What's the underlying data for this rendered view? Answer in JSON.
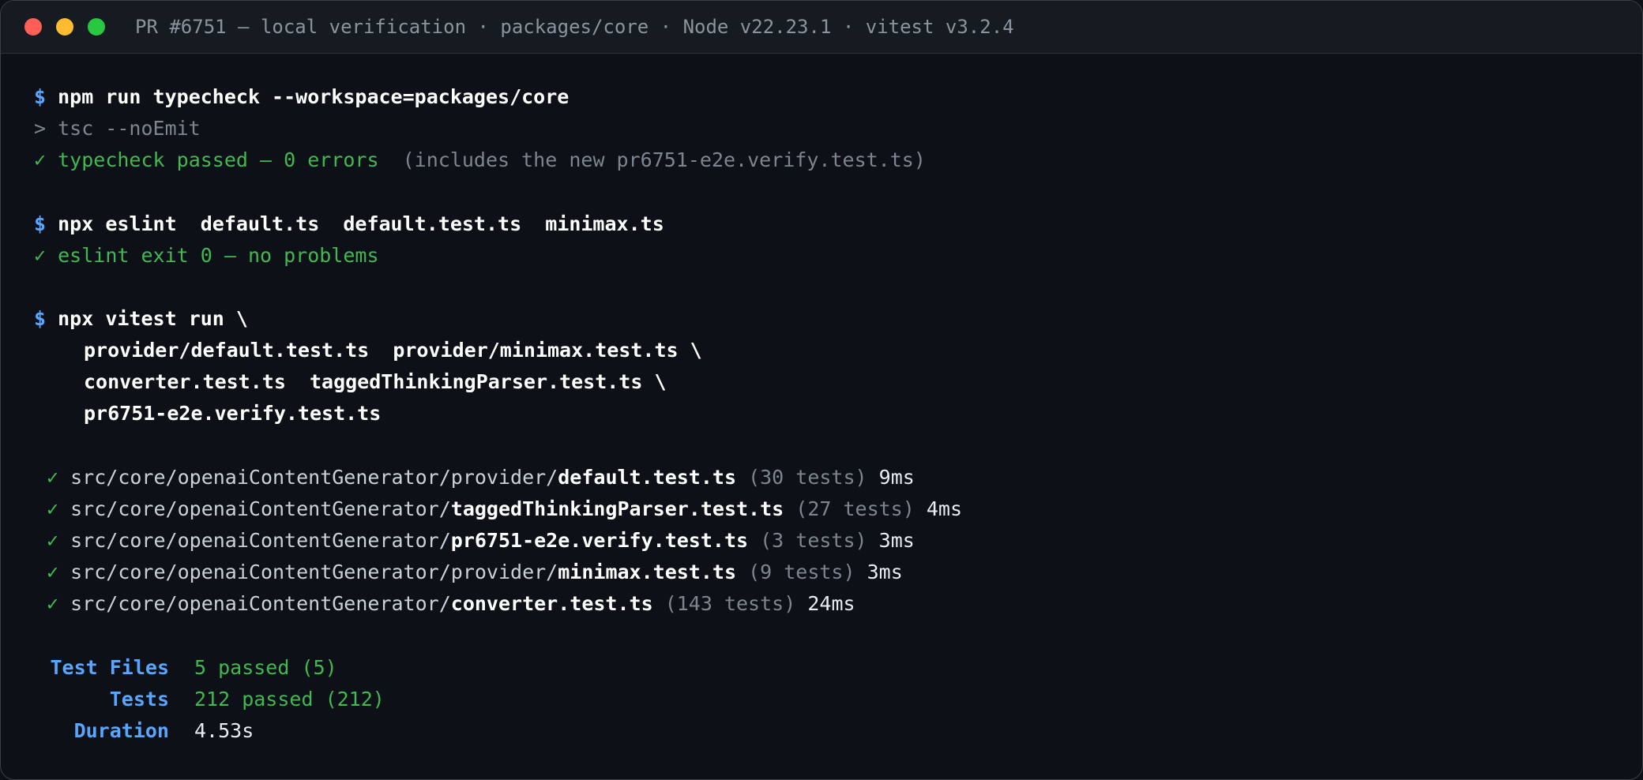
{
  "window": {
    "title": "PR #6751 — local verification · packages/core · Node v22.23.1 · vitest v3.2.4",
    "controls": [
      "close",
      "minimize",
      "maximize"
    ]
  },
  "colors": {
    "background": "#0d1117",
    "prompt": "#58a6ff",
    "success": "#3fb950",
    "dim": "#7d8590"
  },
  "terminal": {
    "prompt_symbol": "$",
    "check_symbol": "✓",
    "block1": {
      "command": "npm run typecheck --workspace=packages/core",
      "echo": "> tsc --noEmit",
      "result": "typecheck passed — 0 errors",
      "note": "  (includes the new pr6751-e2e.verify.test.ts)"
    },
    "block2": {
      "command": "npx eslint  default.ts  default.test.ts  minimax.ts",
      "result": "eslint exit 0 — no problems"
    },
    "block3": {
      "command": "npx vitest run \\",
      "continuation": [
        "provider/default.test.ts  provider/minimax.test.ts \\",
        "converter.test.ts  taggedThinkingParser.test.ts \\",
        "pr6751-e2e.verify.test.ts"
      ]
    },
    "test_results": [
      {
        "dir": "src/core/openaiContentGenerator/provider/",
        "file": "default.test.ts",
        "count": "(30 tests)",
        "time": "9ms"
      },
      {
        "dir": "src/core/openaiContentGenerator/",
        "file": "taggedThinkingParser.test.ts",
        "count": "(27 tests)",
        "time": "4ms"
      },
      {
        "dir": "src/core/openaiContentGenerator/",
        "file": "pr6751-e2e.verify.test.ts",
        "count": "(3 tests)",
        "time": "3ms"
      },
      {
        "dir": "src/core/openaiContentGenerator/provider/",
        "file": "minimax.test.ts",
        "count": "(9 tests)",
        "time": "3ms"
      },
      {
        "dir": "src/core/openaiContentGenerator/",
        "file": "converter.test.ts",
        "count": "(143 tests)",
        "time": "24ms"
      }
    ],
    "summary": {
      "test_files_label": "Test Files",
      "test_files_value": "5 passed (5)",
      "tests_label": "Tests",
      "tests_value": "212 passed (212)",
      "duration_label": "Duration",
      "duration_value": "4.53s"
    }
  }
}
